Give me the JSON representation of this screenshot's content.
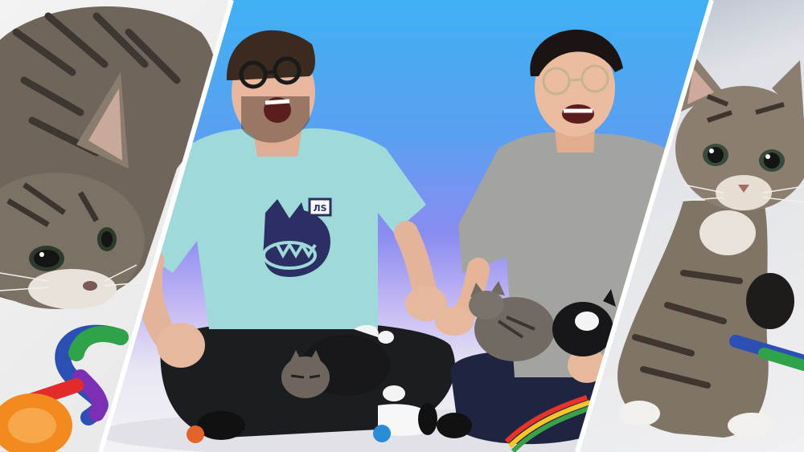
{
  "scene": {
    "palette": {
      "bg_blue": "#3fb0f3",
      "bg_violet": "#8a8cf0",
      "floor": "#f2f2f4",
      "teal_shirt": "#9fd9da",
      "gray_shirt": "#a3a39f",
      "pants": "#1d1e22",
      "tabby": "#7d7266",
      "logo_navy": "#2b2f63"
    },
    "shirt_logo_text": "ЛS"
  }
}
